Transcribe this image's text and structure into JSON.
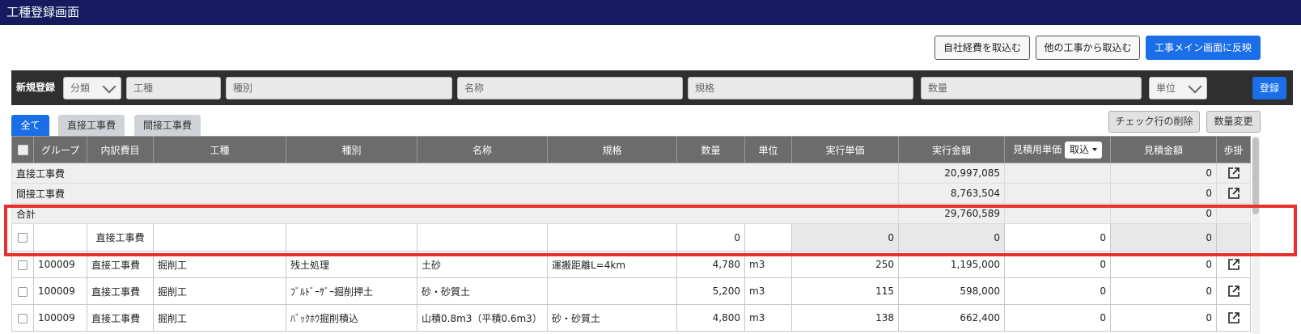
{
  "window": {
    "title": "工種登録画面"
  },
  "toolbar": {
    "import_own_expense": "自社経費を取込む",
    "import_other_work": "他の工事から取込む",
    "reflect_main": "工事メイン画面に反映"
  },
  "register": {
    "label": "新規登録",
    "category_placeholder": "分類",
    "koshu_placeholder": "工種",
    "shubetsu_placeholder": "種別",
    "name_placeholder": "名称",
    "spec_placeholder": "規格",
    "qty_placeholder": "数量",
    "unit_placeholder": "単位",
    "submit_label": "登録"
  },
  "tabs": {
    "all": "全て",
    "direct": "直接工事費",
    "indirect": "間接工事費"
  },
  "actions": {
    "delete_checked": "チェック行の削除",
    "change_qty": "数量変更"
  },
  "table": {
    "headers": {
      "group": "グループ",
      "breakdown": "内訳費目",
      "koshu": "工種",
      "shubetsu": "種別",
      "name": "名称",
      "spec": "規格",
      "qty": "数量",
      "unit": "単位",
      "exec_unit_price": "実行単価",
      "exec_amount": "実行金額",
      "estimate_unit_price": "見積用単価",
      "import_dropdown": "取込",
      "estimate_amount": "見積金額",
      "buai": "歩掛"
    },
    "summary": [
      {
        "label": "直接工事費",
        "exec_amount": "20,997,085",
        "estimate_amount": "0"
      },
      {
        "label": "間接工事費",
        "exec_amount": "8,763,504",
        "estimate_amount": "0"
      },
      {
        "label": "合計",
        "exec_amount": "29,760,589",
        "estimate_amount": "0"
      }
    ],
    "input_row": {
      "breakdown": "直接工事費",
      "qty": "0",
      "exec_unit_price": "0",
      "exec_amount": "0",
      "estimate_unit_price": "0",
      "estimate_amount": "0"
    },
    "rows": [
      {
        "group": "100009",
        "breakdown": "直接工事費",
        "koshu": "掘削工",
        "shubetsu": "残土処理",
        "name": "土砂",
        "spec": "運搬距離L=4km",
        "qty": "4,780",
        "unit": "m3",
        "exec_unit_price": "250",
        "exec_amount": "1,195,000",
        "estimate_unit_price": "0",
        "estimate_amount": "0"
      },
      {
        "group": "100009",
        "breakdown": "直接工事費",
        "koshu": "掘削工",
        "shubetsu": "ﾌﾞﾙﾄﾞｰｻﾞｰ掘削押土",
        "name": "砂・砂質土",
        "spec": "",
        "qty": "5,200",
        "unit": "m3",
        "exec_unit_price": "115",
        "exec_amount": "598,000",
        "estimate_unit_price": "0",
        "estimate_amount": "0"
      },
      {
        "group": "100009",
        "breakdown": "直接工事費",
        "koshu": "掘削工",
        "shubetsu": "ﾊﾞｯｸﾎｳ掘削積込",
        "name": "山積0.8m3（平積0.6m3）",
        "spec": "砂・砂質土",
        "qty": "4,800",
        "unit": "m3",
        "exec_unit_price": "138",
        "exec_amount": "662,400",
        "estimate_unit_price": "0",
        "estimate_amount": "0"
      }
    ]
  }
}
